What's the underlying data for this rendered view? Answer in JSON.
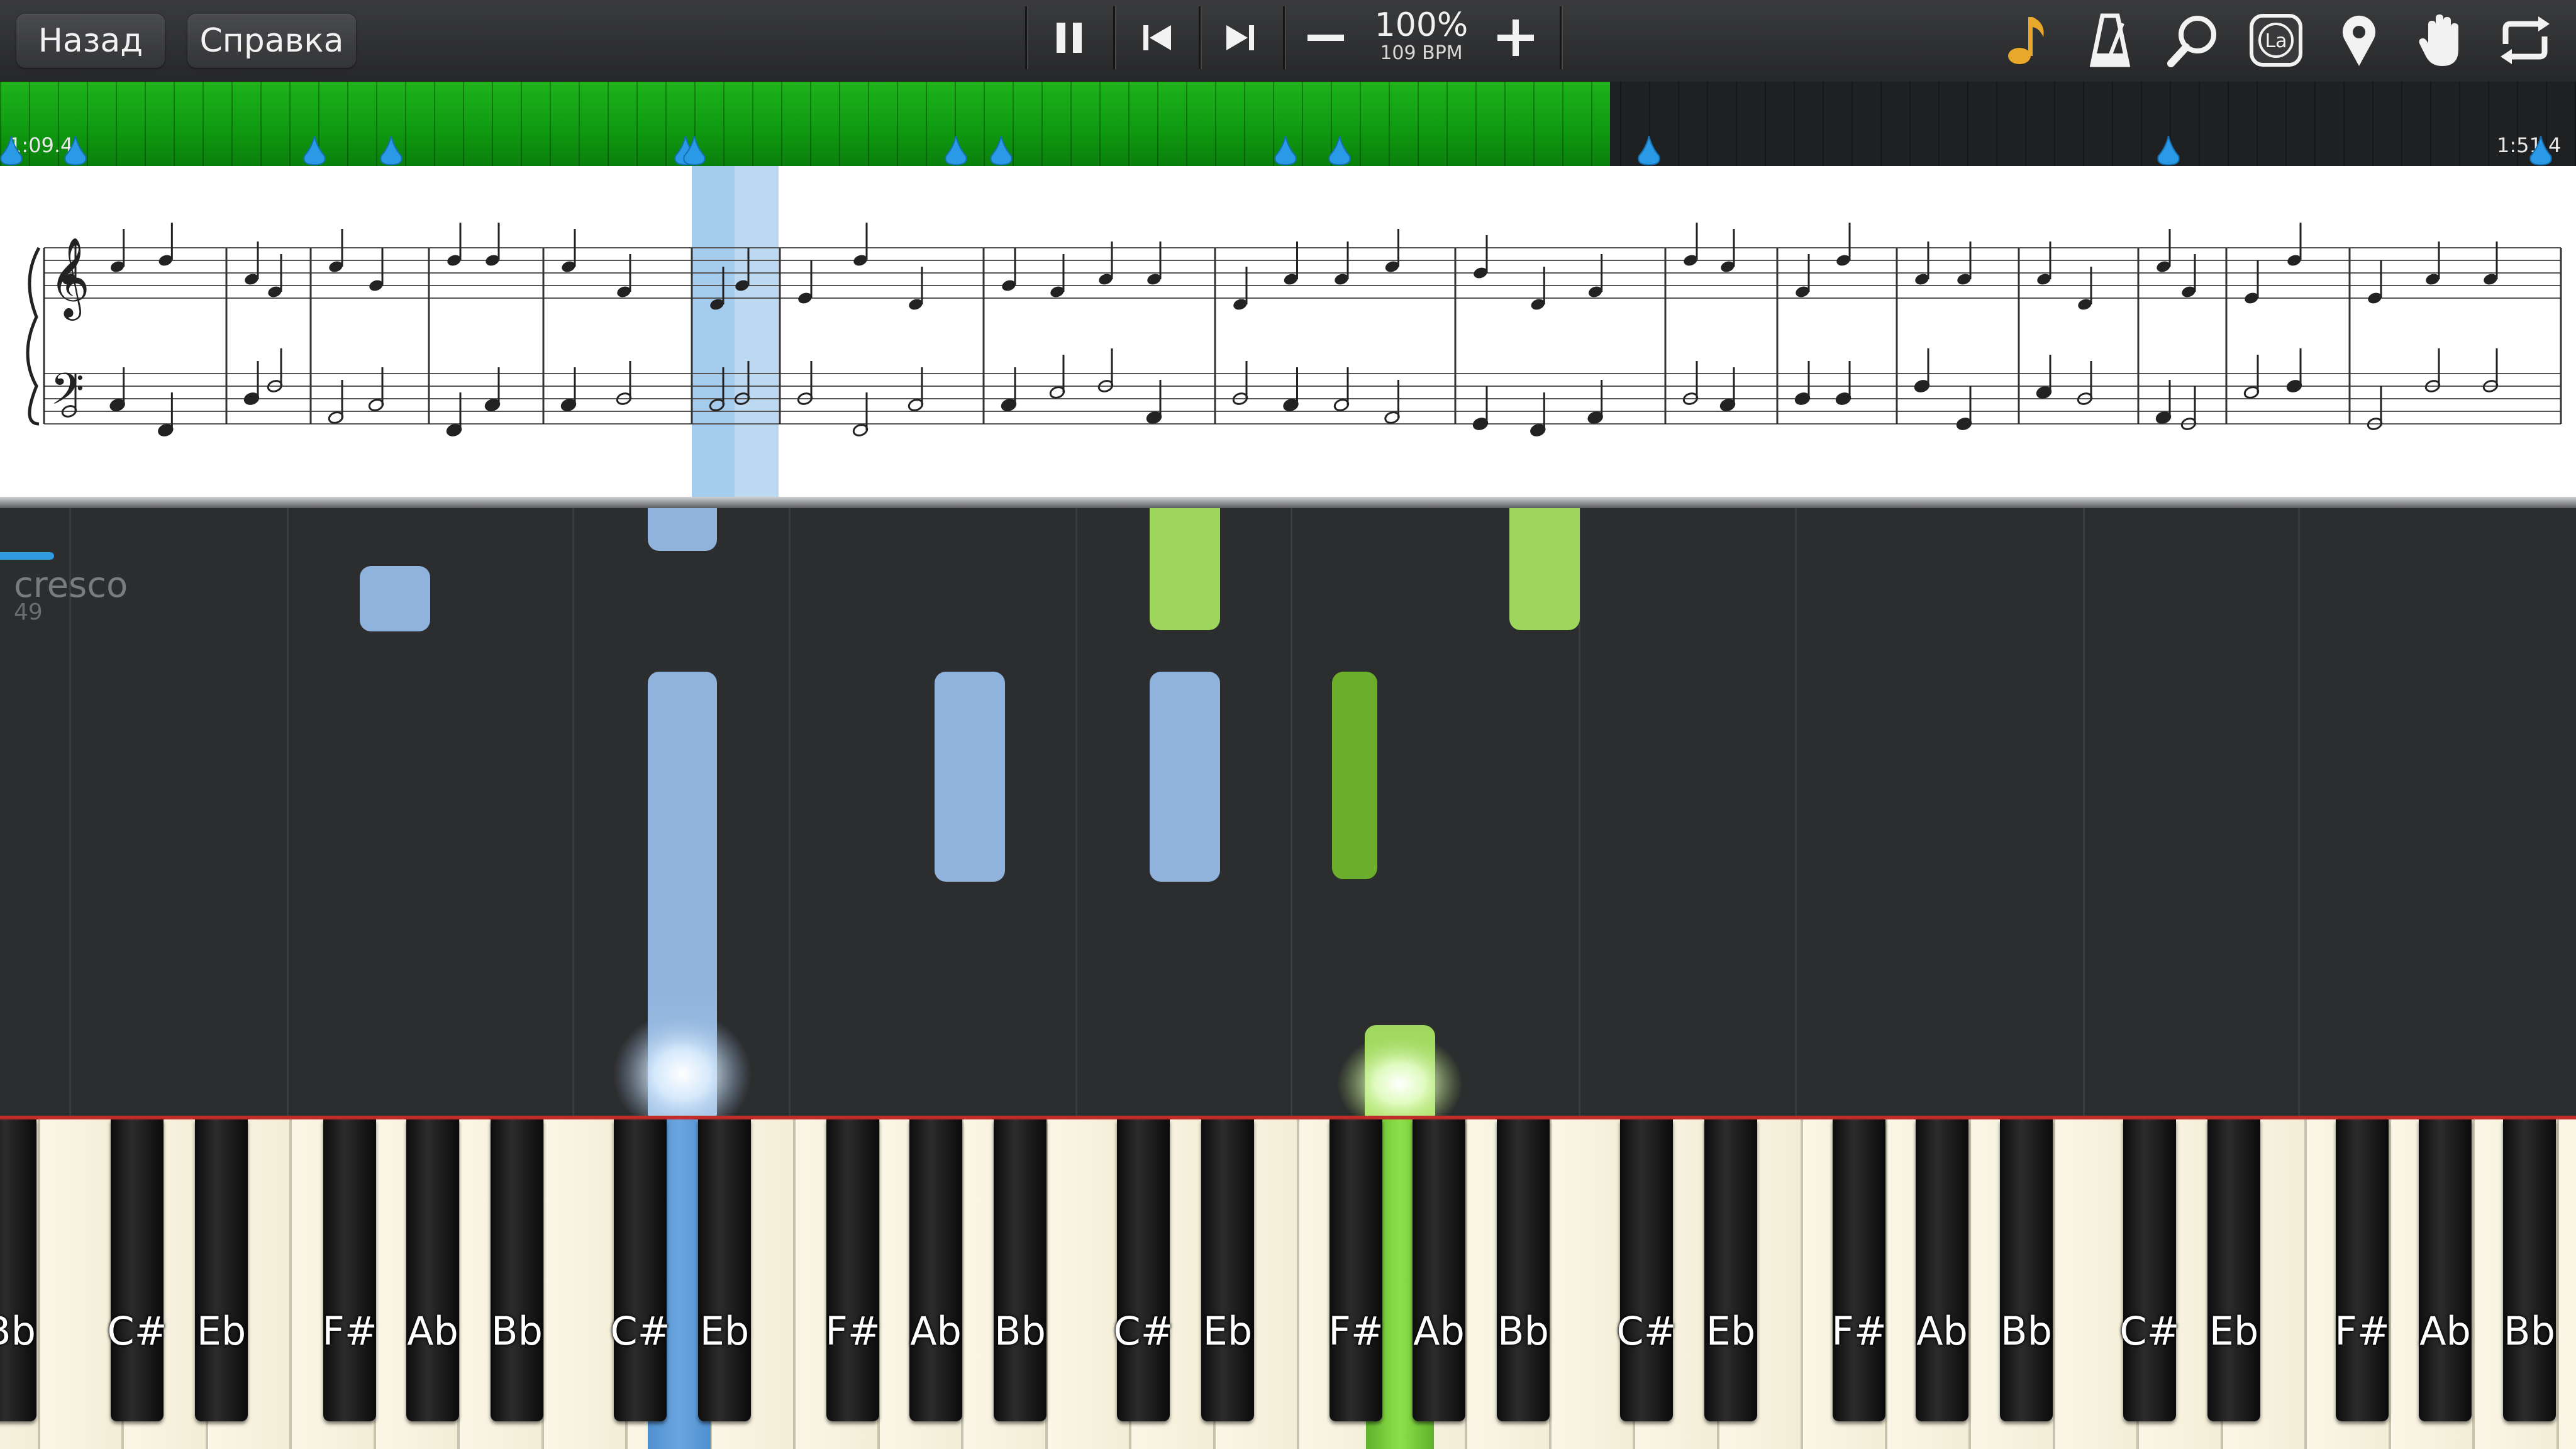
{
  "toolbar": {
    "back_label": "Назад",
    "help_label": "Справка",
    "tempo_percent": "100%",
    "tempo_bpm": "109 BPM"
  },
  "timeline": {
    "start_time": "1:09.4",
    "end_time": "1:51.4"
  },
  "roll": {
    "annotation": "cresco",
    "measure_number": "49"
  },
  "keyboard": {
    "black_key_labels": [
      "Bb",
      "C#",
      "Eb",
      "F#",
      "Ab",
      "Bb",
      "C#",
      "Eb",
      "F#",
      "Ab",
      "Bb",
      "C#",
      "Eb",
      "F#",
      "Ab",
      "Bb",
      "C#",
      "Eb",
      "F#",
      "Ab",
      "Bb",
      "C#",
      "Eb",
      "F#",
      "Ab",
      "Bb"
    ]
  },
  "colors": {
    "left_hand": "#8fb3dc",
    "right_hand": "#9fd65e",
    "timeline_played": "#17a917"
  }
}
